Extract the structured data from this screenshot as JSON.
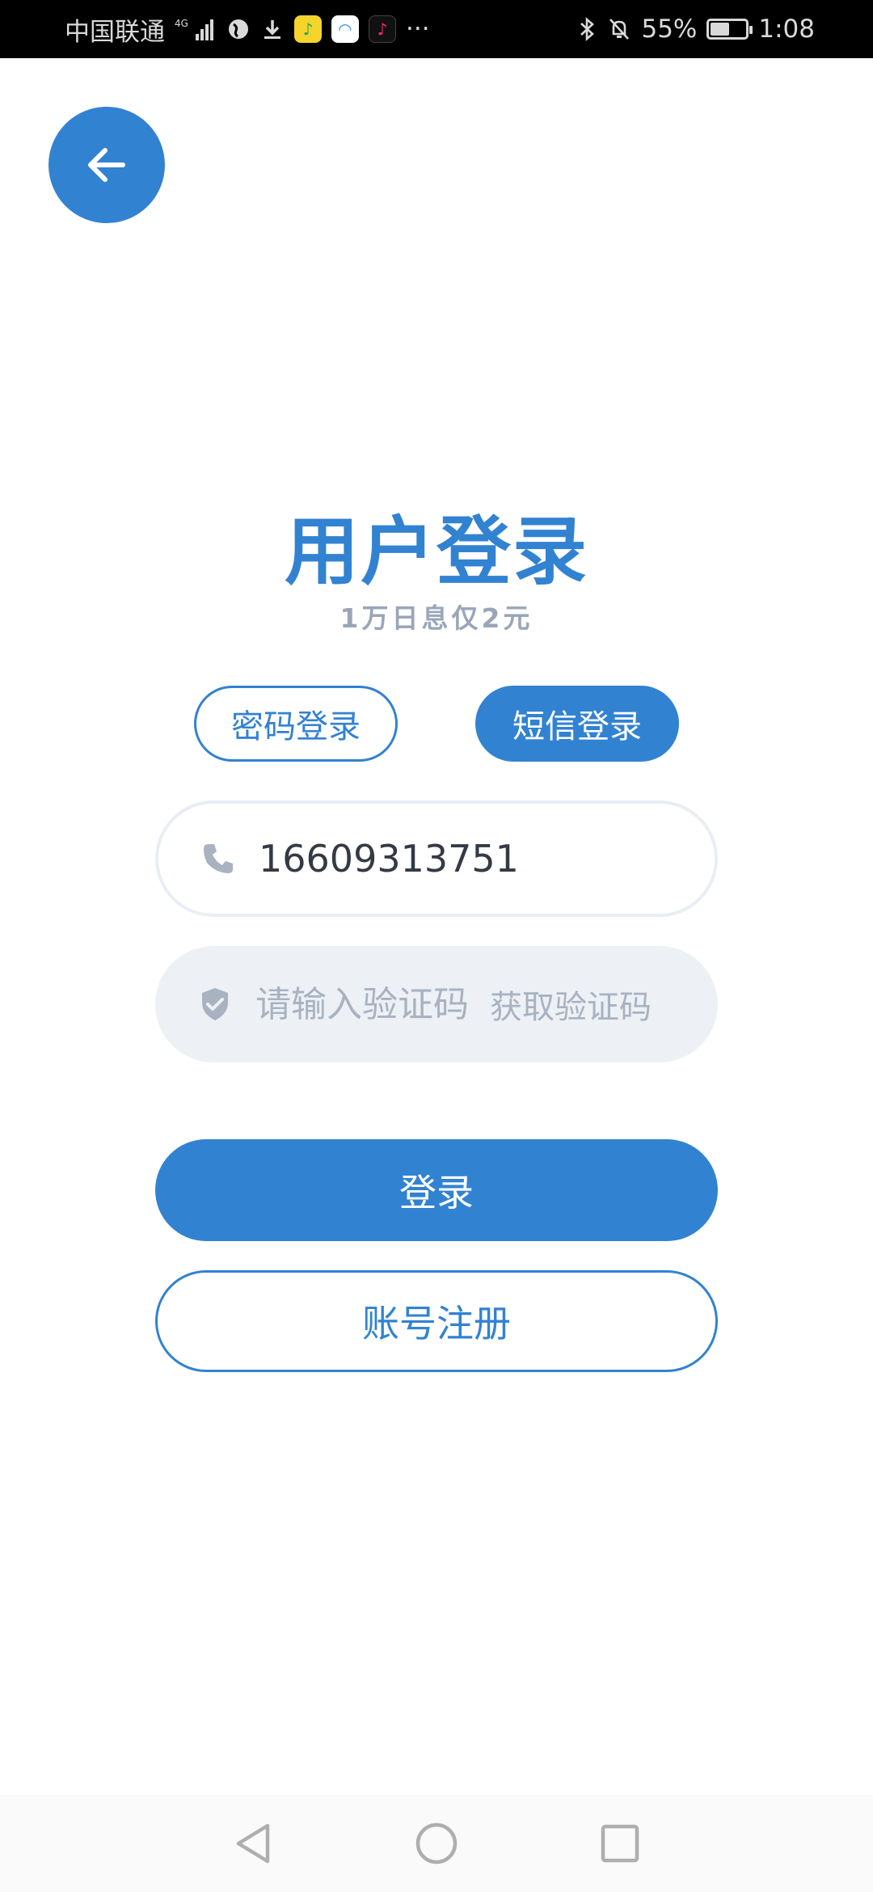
{
  "status_bar": {
    "carrier": "中国联通",
    "network": "4G",
    "battery": "55%",
    "battery_level": 0.55,
    "time": "1:08",
    "more": "···"
  },
  "icons": {
    "back": "arrow-left-icon",
    "phone": "phone-icon",
    "code": "shield-check-icon"
  },
  "colors": {
    "primary": "#3282D2",
    "subtitle": "#9AA6B8",
    "placeholder": "#A8B2C0",
    "input_bg": "#EDF1F6"
  },
  "header": {
    "title": "用户登录",
    "subtitle": "1万日息仅2元"
  },
  "tabs": [
    {
      "label": "密码登录",
      "active": false
    },
    {
      "label": "短信登录",
      "active": true
    }
  ],
  "form": {
    "phone_value": "16609313751",
    "code_placeholder": "请输入验证码",
    "get_code_label": "获取验证码"
  },
  "buttons": {
    "login": "登录",
    "register": "账号注册"
  }
}
